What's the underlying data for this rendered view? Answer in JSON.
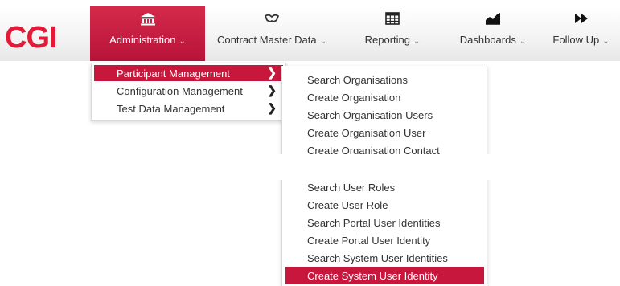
{
  "logo": "CGI",
  "nav": [
    {
      "label": "Administration",
      "icon": "bank-icon"
    },
    {
      "label": "Contract Master Data",
      "icon": "handshake-icon"
    },
    {
      "label": "Reporting",
      "icon": "table-icon"
    },
    {
      "label": "Dashboards",
      "icon": "area-chart-icon"
    },
    {
      "label": "Follow Up",
      "icon": "fast-forward-icon"
    }
  ],
  "menu_level1": [
    {
      "label": "Participant Management"
    },
    {
      "label": "Configuration Management"
    },
    {
      "label": "Test Data Management"
    }
  ],
  "menu_level2": [
    {
      "label": "Search Organisations"
    },
    {
      "label": "Create Organisation"
    },
    {
      "label": "Search Organisation Users"
    },
    {
      "label": "Create Organisation User"
    },
    {
      "label": "Create Organisation Contact"
    },
    {
      "label": "Search User Roles"
    },
    {
      "label": "Create User Role"
    },
    {
      "label": "Search Portal User Identities"
    },
    {
      "label": "Create Portal User Identity"
    },
    {
      "label": "Search System User Identities"
    },
    {
      "label": "Create System User Identity"
    }
  ],
  "colors": {
    "accent": "#c8173d",
    "logo": "#e31937"
  }
}
